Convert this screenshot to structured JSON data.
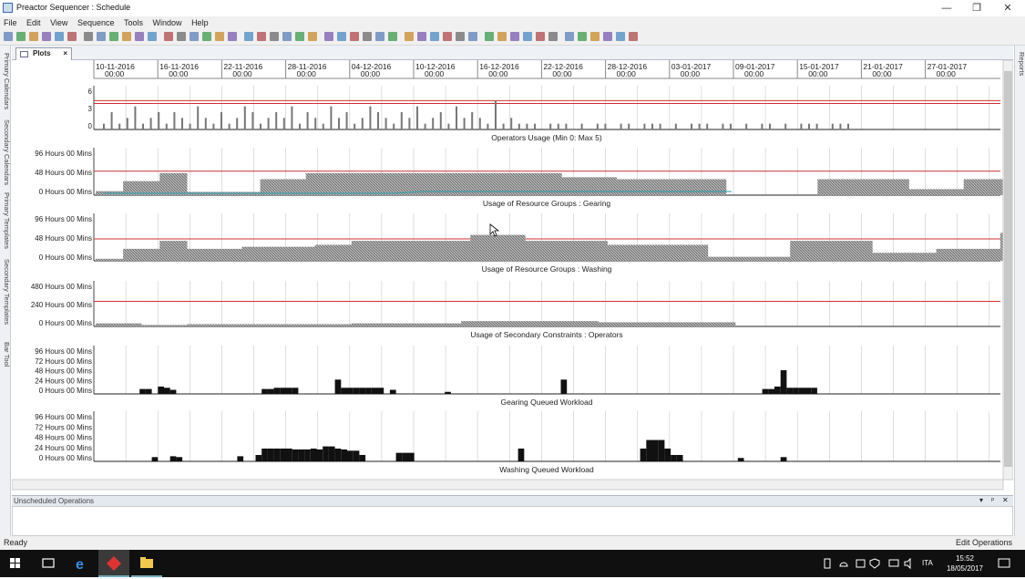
{
  "window": {
    "title": "Preactor Sequencer : Schedule",
    "minimize": "—",
    "restore": "❐",
    "close": "✕"
  },
  "menu": [
    "File",
    "Edit",
    "View",
    "Sequence",
    "Tools",
    "Window",
    "Help"
  ],
  "left_dock_tabs": [
    "Primary Calendars",
    "Secondary Calendars",
    "Primary Templates",
    "Secondary Templates",
    "Bar Tool"
  ],
  "right_dock_tabs": [
    "Reports"
  ],
  "document_tab": {
    "label": "Plots",
    "close": "×"
  },
  "date_axis": {
    "ticks": [
      "10-11-2016",
      "16-11-2016",
      "22-11-2016",
      "28-11-2016",
      "04-12-2016",
      "10-12-2016",
      "16-12-2016",
      "22-12-2016",
      "28-12-2016",
      "03-01-2017",
      "09-01-2017",
      "15-01-2017",
      "21-01-2017",
      "27-01-2017"
    ],
    "time": "00:00"
  },
  "chart_data": [
    {
      "type": "bar",
      "title": "Operators Usage (Min 0: Max 5)",
      "y_ticks": [
        "6",
        "3",
        "0"
      ],
      "ylim": [
        0,
        6
      ],
      "limit_lines": [
        4.5,
        5
      ],
      "x_start": "10-11-2016",
      "series": [
        {
          "values": [
            1,
            3,
            1,
            2,
            4,
            1,
            2,
            3,
            1,
            3,
            2,
            1,
            4,
            2,
            1,
            3,
            1,
            2,
            4,
            3,
            1,
            2,
            3,
            2,
            4,
            1,
            3,
            2,
            1,
            4,
            2,
            3,
            1,
            2,
            4,
            3,
            2,
            1,
            3,
            2,
            4,
            1,
            2,
            3,
            1,
            4,
            2,
            3,
            2,
            1,
            5,
            1,
            2,
            1,
            1,
            1,
            0,
            1,
            1,
            1,
            0,
            1,
            0,
            1,
            1,
            0,
            1,
            1,
            0,
            1,
            1,
            1,
            0,
            1,
            0,
            1,
            1,
            1,
            0,
            1,
            1,
            0,
            1,
            0,
            1,
            1,
            0,
            1,
            0,
            1,
            1,
            1,
            0,
            1,
            1,
            1,
            0,
            0,
            0,
            0
          ]
        }
      ]
    },
    {
      "type": "area",
      "title": "Usage of Resource Groups : Gearing",
      "y_ticks": [
        "96 Hours 00 Mins",
        "48 Hours 00 Mins",
        "0 Hours 00 Mins"
      ],
      "ylim": [
        0,
        96
      ],
      "limit_lines": [
        60
      ],
      "x_start": "10-11-2016",
      "series": [
        {
          "values": [
            10,
            10,
            10,
            35,
            35,
            35,
            35,
            55,
            55,
            55,
            8,
            8,
            8,
            8,
            8,
            8,
            8,
            8,
            40,
            40,
            40,
            40,
            40,
            55,
            55,
            55,
            55,
            55,
            55,
            55,
            55,
            55,
            55,
            55,
            55,
            55,
            55,
            55,
            55,
            55,
            55,
            55,
            55,
            55,
            55,
            55,
            55,
            55,
            55,
            55,
            55,
            45,
            45,
            45,
            45,
            45,
            45,
            40,
            40,
            40,
            40,
            40,
            40,
            40,
            40,
            40,
            40,
            40,
            40,
            0,
            0,
            0,
            0,
            0,
            0,
            0,
            0,
            0,
            0,
            40,
            40,
            40,
            40,
            40,
            40,
            40,
            40,
            40,
            40,
            15,
            15,
            15,
            15,
            15,
            15,
            40,
            40,
            40,
            40,
            40
          ]
        }
      ]
    },
    {
      "type": "area",
      "title": "Usage of Resource Groups : Washing",
      "y_ticks": [
        "96 Hours 00 Mins",
        "48 Hours 00 Mins",
        "0 Hours 00 Mins"
      ],
      "ylim": [
        0,
        96
      ],
      "limit_lines": [
        55
      ],
      "x_start": "10-11-2016",
      "series": [
        {
          "values": [
            5,
            5,
            5,
            30,
            30,
            30,
            30,
            50,
            50,
            50,
            30,
            30,
            30,
            30,
            30,
            30,
            35,
            35,
            35,
            35,
            35,
            35,
            35,
            35,
            40,
            40,
            40,
            40,
            50,
            50,
            50,
            50,
            50,
            50,
            50,
            50,
            50,
            50,
            50,
            50,
            50,
            65,
            65,
            65,
            65,
            65,
            65,
            50,
            50,
            50,
            50,
            50,
            50,
            50,
            50,
            50,
            40,
            40,
            40,
            40,
            40,
            40,
            40,
            40,
            40,
            40,
            40,
            10,
            10,
            10,
            10,
            10,
            10,
            10,
            10,
            10,
            50,
            50,
            50,
            50,
            50,
            50,
            50,
            50,
            50,
            20,
            20,
            20,
            20,
            20,
            20,
            20,
            30,
            30,
            30,
            30,
            30,
            30,
            30,
            70
          ]
        }
      ]
    },
    {
      "type": "area",
      "title": "Usage of Secondary Constraints : Operators",
      "y_ticks": [
        "480 Hours 00 Mins",
        "240 Hours 00 Mins",
        "0 Hours 00 Mins"
      ],
      "ylim": [
        0,
        480
      ],
      "limit_lines": [
        330
      ],
      "x_start": "10-11-2016",
      "series": [
        {
          "values": [
            40,
            40,
            40,
            40,
            40,
            20,
            20,
            20,
            20,
            20,
            30,
            30,
            30,
            30,
            30,
            30,
            30,
            30,
            30,
            30,
            30,
            30,
            30,
            30,
            30,
            30,
            30,
            30,
            40,
            40,
            40,
            40,
            40,
            40,
            40,
            40,
            40,
            40,
            40,
            40,
            70,
            70,
            70,
            70,
            70,
            70,
            70,
            70,
            70,
            70,
            70,
            70,
            70,
            70,
            70,
            55,
            55,
            55,
            55,
            55,
            55,
            55,
            55,
            55,
            55,
            55,
            55,
            55,
            55,
            55,
            0,
            0,
            0,
            0,
            0,
            0,
            0,
            0,
            0,
            0,
            0,
            0,
            0,
            0,
            0,
            0,
            0,
            0,
            0,
            0,
            0,
            0,
            0,
            0,
            0,
            0,
            0,
            0,
            0,
            0
          ]
        }
      ]
    },
    {
      "type": "bar",
      "title": "Gearing Queued Workload",
      "y_ticks": [
        "96 Hours 00 Mins",
        "72 Hours 00 Mins",
        "48 Hours 00 Mins",
        "24 Hours 00 Mins",
        "0 Hours 00 Mins"
      ],
      "ylim": [
        0,
        96
      ],
      "x_start": "10-11-2016",
      "series": [
        {
          "values": [
            0,
            0,
            0,
            0,
            0,
            0,
            12,
            12,
            0,
            18,
            15,
            10,
            0,
            0,
            0,
            0,
            0,
            0,
            0,
            0,
            0,
            0,
            0,
            0,
            0,
            0,
            12,
            12,
            15,
            15,
            15,
            15,
            0,
            0,
            0,
            0,
            0,
            0,
            35,
            15,
            15,
            15,
            15,
            15,
            15,
            15,
            0,
            10,
            0,
            0,
            0,
            0,
            0,
            0,
            0,
            0,
            5,
            0,
            0,
            0,
            0,
            0,
            0,
            0,
            0,
            0,
            0,
            0,
            0,
            0,
            0,
            0,
            0,
            0,
            0,
            35,
            0,
            0,
            0,
            0,
            0,
            0,
            0,
            0,
            0,
            0,
            0,
            0,
            0,
            0,
            0,
            0,
            0,
            0,
            0,
            0,
            0,
            0,
            0,
            0,
            0,
            0,
            0,
            0,
            0,
            0,
            0,
            0,
            12,
            12,
            18,
            58,
            15,
            15,
            15,
            15,
            15,
            0,
            0,
            0,
            0,
            0,
            0,
            0,
            0,
            0,
            0,
            0,
            0,
            0,
            0,
            0,
            0,
            0
          ]
        }
      ]
    },
    {
      "type": "bar",
      "title": "Washing Queued Workload",
      "y_ticks": [
        "96 Hours 00 Mins",
        "72 Hours 00 Mins",
        "48 Hours 00 Mins",
        "24 Hours 00 Mins",
        "0 Hours 00 Mins"
      ],
      "ylim": [
        0,
        96
      ],
      "x_start": "10-11-2016",
      "series": [
        {
          "values": [
            0,
            0,
            0,
            0,
            0,
            0,
            0,
            0,
            10,
            0,
            0,
            12,
            10,
            0,
            0,
            0,
            0,
            0,
            0,
            0,
            0,
            0,
            12,
            0,
            0,
            15,
            30,
            30,
            30,
            30,
            30,
            28,
            28,
            28,
            30,
            28,
            35,
            35,
            30,
            28,
            25,
            25,
            15,
            0,
            0,
            0,
            0,
            0,
            20,
            20,
            20,
            0,
            0,
            0,
            0,
            0,
            0,
            0,
            0,
            0,
            0,
            0,
            0,
            0,
            0,
            0,
            0,
            0,
            30,
            0,
            0,
            0,
            0,
            0,
            0,
            0,
            0,
            0,
            0,
            0,
            0,
            0,
            0,
            0,
            0,
            0,
            0,
            0,
            30,
            50,
            50,
            50,
            30,
            15,
            15,
            0,
            0,
            0,
            0,
            0,
            0,
            0,
            0,
            0,
            8,
            0,
            0,
            0,
            0,
            0,
            0,
            10,
            0,
            0,
            0,
            0,
            0,
            0,
            0,
            0,
            0,
            0,
            0,
            0,
            0,
            0,
            0,
            0,
            0,
            0,
            0,
            0,
            0,
            0,
            0,
            0
          ]
        }
      ]
    }
  ],
  "unscheduled_panel": {
    "title": "Unscheduled Operations",
    "menu": "▾",
    "pin": "ᵖ",
    "close": "✕"
  },
  "status": {
    "left": "Ready",
    "right": "Edit Operations"
  },
  "taskbar": {
    "lang": "ITA",
    "time": "15:52",
    "date": "18/05/2017"
  },
  "colors": {
    "limit_line": "#d03030",
    "bar_fill": "#9a9a9a",
    "workload_fill": "#111111",
    "min_line": "#2aa0b0"
  }
}
